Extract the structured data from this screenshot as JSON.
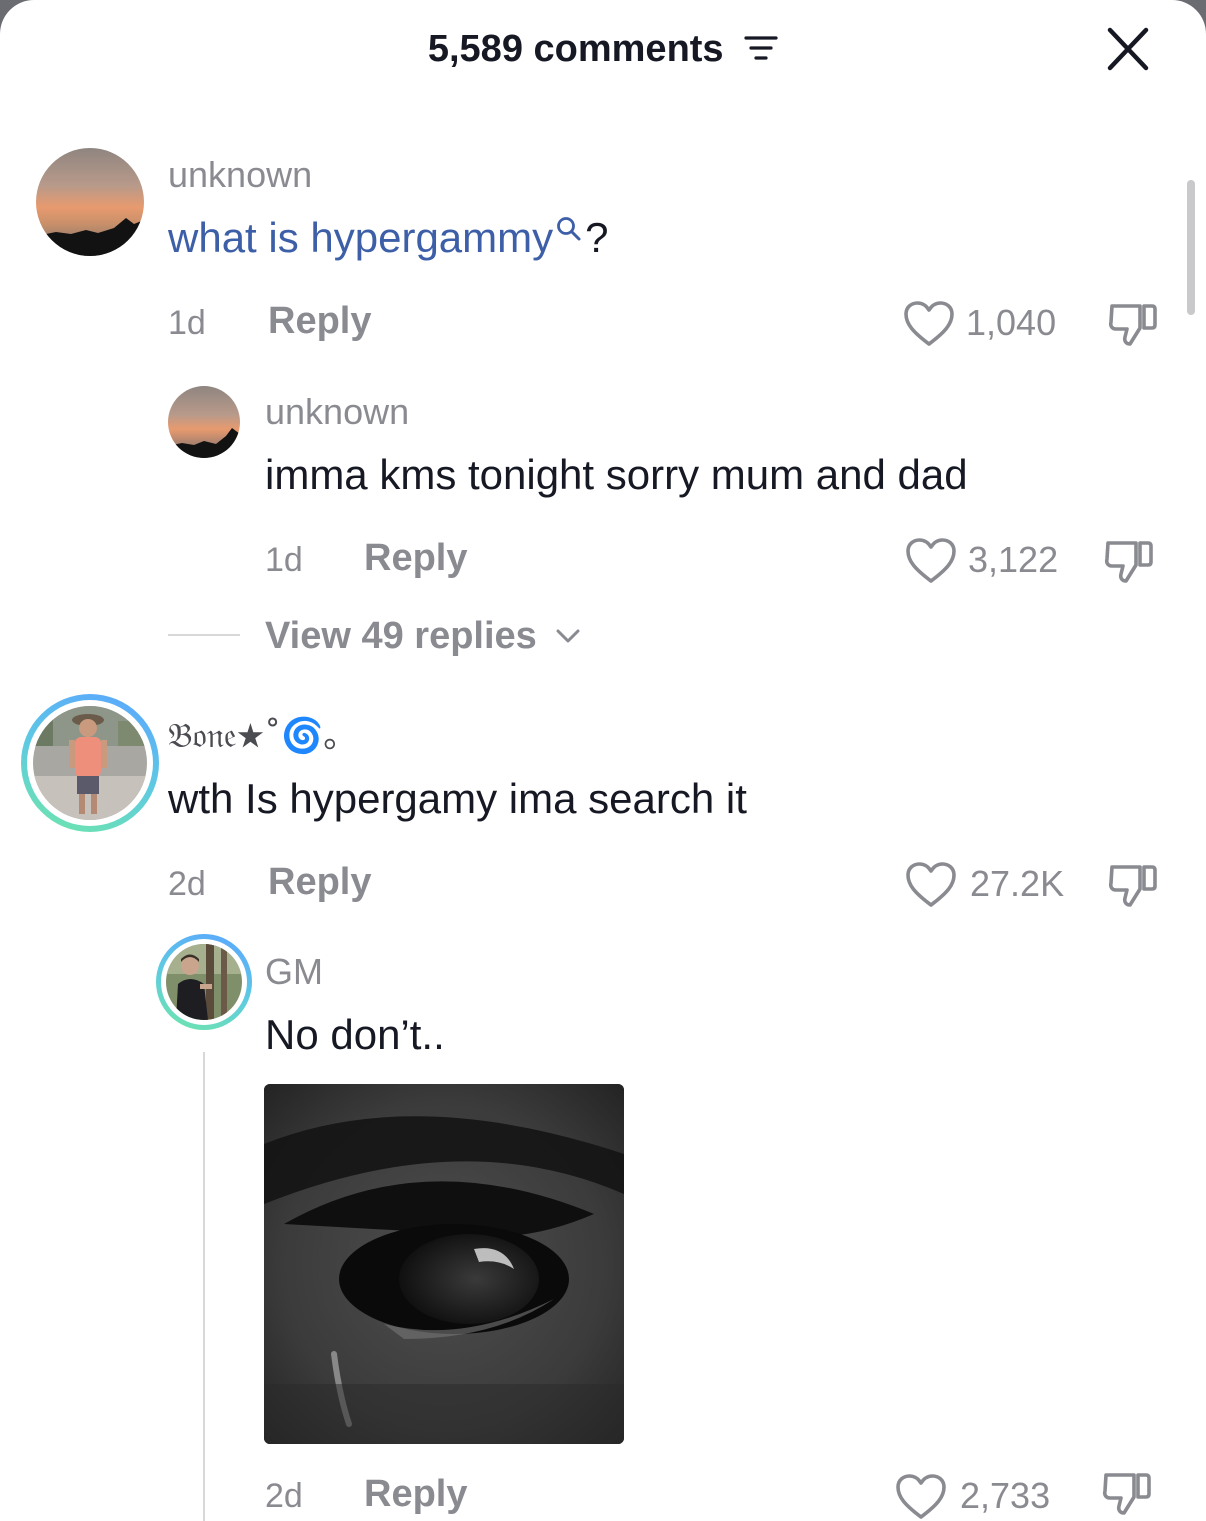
{
  "header": {
    "title": "5,589 comments"
  },
  "comments": [
    {
      "username": "unknown",
      "text_link": "what is hypergammy",
      "text_suffix": "?",
      "time": "1d",
      "reply_label": "Reply",
      "likes": "1,040"
    },
    {
      "username": "unknown",
      "text": "imma kms tonight sorry mum and dad",
      "time": "1d",
      "reply_label": "Reply",
      "likes": "3,122",
      "view_replies": "View 49 replies"
    },
    {
      "username": "𝔅𝔬𝔫𝔢★˚🌀｡",
      "text": "wth Is hypergamy ima search it",
      "time": "2d",
      "reply_label": "Reply",
      "likes": "27.2K"
    },
    {
      "username": "GM",
      "text": "No don’t..",
      "time": "2d",
      "reply_label": "Reply",
      "likes": "2,733"
    }
  ],
  "colors": {
    "link": "#3d5fa8",
    "muted": "#8a8b91",
    "text": "#161823",
    "story_ring_start": "#5aa4ff",
    "story_ring_end": "#6fe7a8"
  },
  "icons": [
    "filter-icon",
    "close-icon",
    "search-icon",
    "heart-icon",
    "dislike-icon",
    "chevron-down-icon"
  ]
}
